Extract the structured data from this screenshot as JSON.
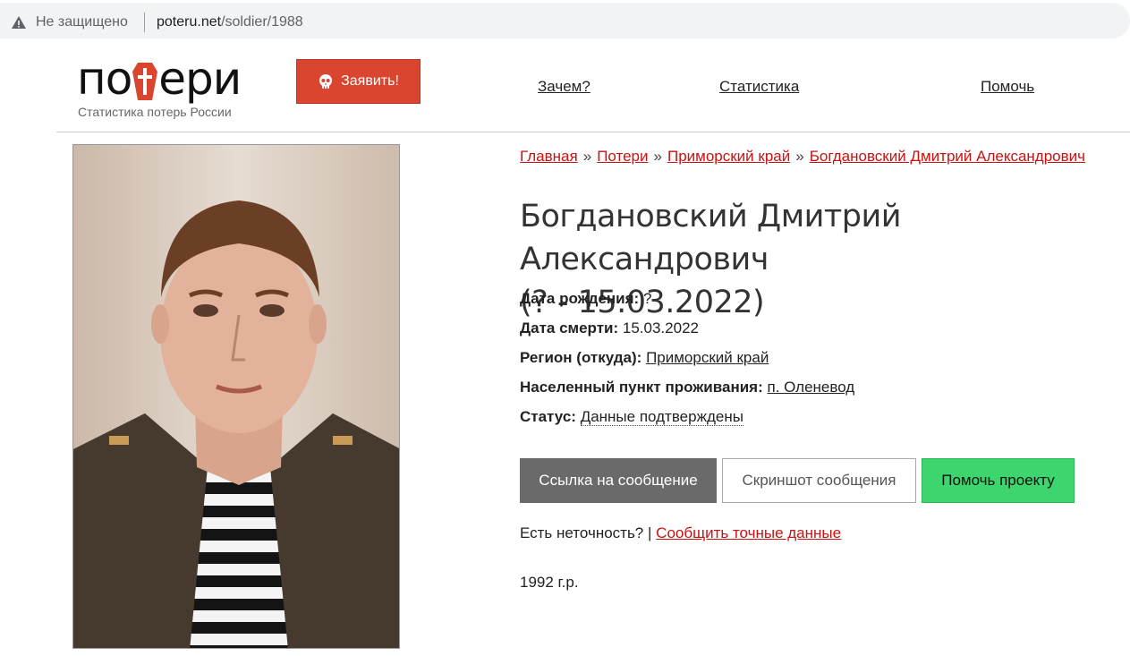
{
  "browser": {
    "security_label": "Не защищено",
    "url_host": "poteru.net",
    "url_path": "/soldier/1988"
  },
  "header": {
    "logo_prefix": "по",
    "logo_suffix": "ери",
    "logo_subtitle": "Статистика потерь России",
    "report_button": "Заявить!",
    "nav": [
      "Зачем?",
      "Статистика",
      "Помочь"
    ],
    "accent_color": "#d9452e"
  },
  "breadcrumb": {
    "items": [
      "Главная",
      "Потери",
      "Приморский край",
      "Богдановский Дмитрий Александрович"
    ],
    "separator": "»"
  },
  "person": {
    "name": "Богдановский Дмитрий Александрович",
    "dates": "(? - 15.03.2022)",
    "fields": [
      {
        "label": "Дата рождения:",
        "value": "?"
      },
      {
        "label": "Дата смерти:",
        "value": "15.03.2022"
      },
      {
        "label": "Регион (откуда):",
        "value": "Приморский край"
      },
      {
        "label": "Населенный пункт проживания:",
        "value": "п. Оленевод"
      },
      {
        "label": "Статус:",
        "value": "Данные подтверждены"
      }
    ],
    "note": "1992 г.р."
  },
  "actions": {
    "link_button": "Ссылка на сообщение",
    "screenshot_button": "Скриншот сообщения",
    "help_button": "Помочь проекту"
  },
  "correction": {
    "question": "Есть неточность?",
    "separator": "|",
    "link": "Сообщить точные данные"
  }
}
